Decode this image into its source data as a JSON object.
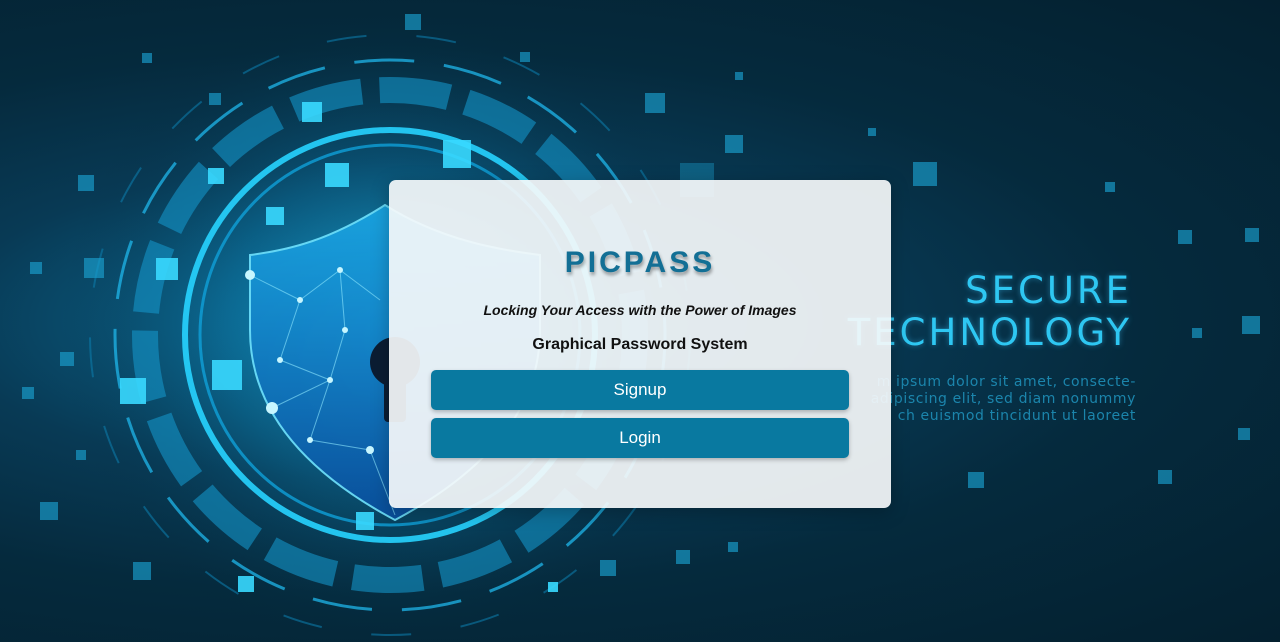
{
  "brand": {
    "logo_text": "PICPASS",
    "tagline": "Locking Your Access with the Power of Images",
    "subtitle": "Graphical Password System"
  },
  "actions": {
    "signup_label": "Signup",
    "login_label": "Login"
  },
  "background": {
    "heading_line1": "SECURE",
    "heading_line2": "TECHNOLOGY",
    "body_line1": "m ipsum dolor sit amet, consecte-",
    "body_line2": "adipiscing elit, sed diam nonummy",
    "body_line3": "ch euismod tincidunt ut laoreet",
    "icons": [
      "shield-icon",
      "keyhole-icon"
    ]
  },
  "colors": {
    "accent": "#126f95",
    "button": "#0979a0",
    "background_dark": "#04202f",
    "glow": "#2ec7f2"
  }
}
